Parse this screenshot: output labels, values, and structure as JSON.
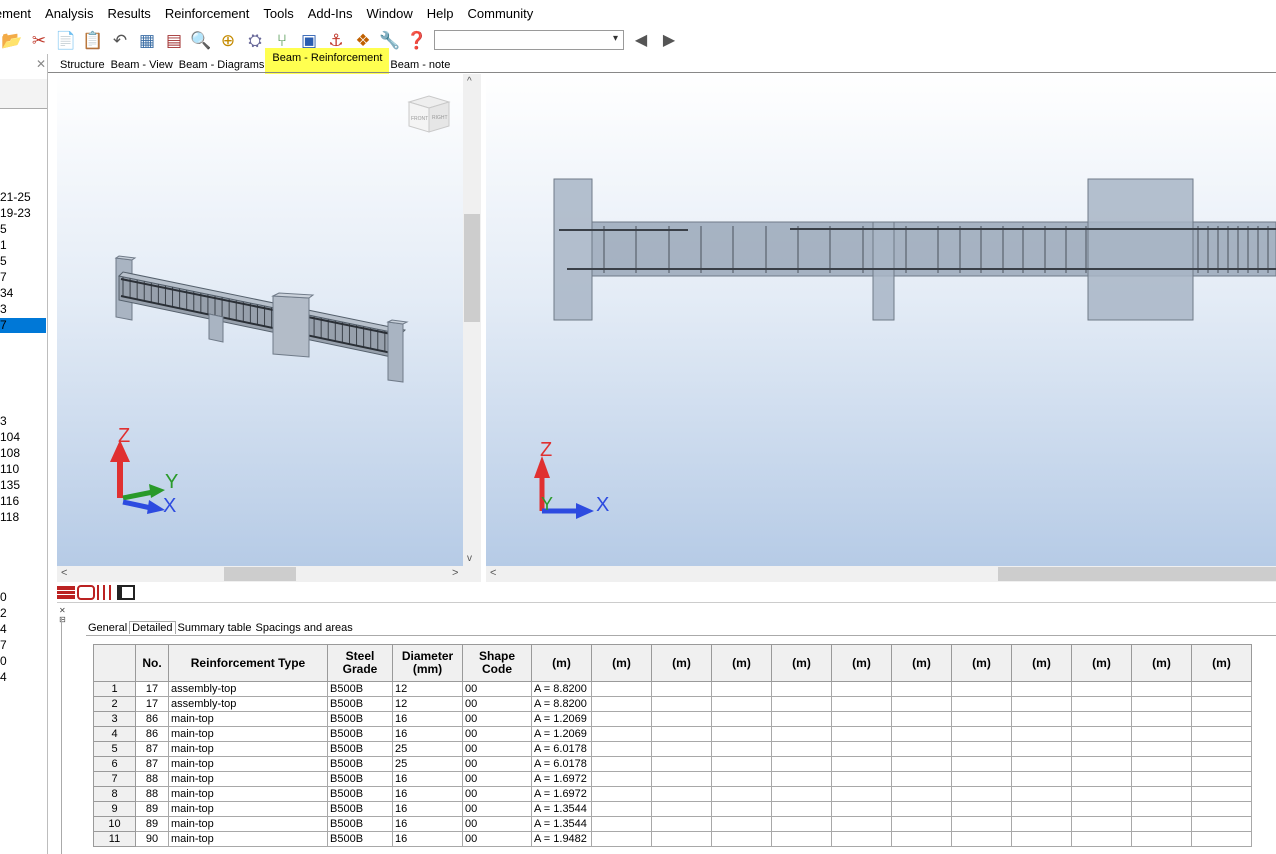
{
  "menu": [
    "lement",
    "Analysis",
    "Results",
    "Reinforcement",
    "Tools",
    "Add-Ins",
    "Window",
    "Help",
    "Community"
  ],
  "toolbar": {
    "icons": [
      "open-icon",
      "cut-icon",
      "copy-icon",
      "paste-icon",
      "undo-icon",
      "grid-icon",
      "calculator-icon",
      "zoom-icon",
      "zoom-window-icon",
      "model-icon",
      "branch-icon",
      "layout-icon",
      "rebar-icon",
      "structure-icon",
      "tools-icon",
      "help-icon"
    ],
    "combo_value": "",
    "nav_back": "◀",
    "nav_forward": "▶"
  },
  "left_panel": {
    "items": [
      {
        "text": "21-25",
        "selected": false
      },
      {
        "text": "19-23",
        "selected": false
      },
      {
        "text": "5",
        "selected": false
      },
      {
        "text": "1",
        "selected": false
      },
      {
        "text": "5",
        "selected": false
      },
      {
        "text": "7",
        "selected": false
      },
      {
        "text": "34",
        "selected": false
      },
      {
        "text": "3",
        "selected": false
      },
      {
        "text": "7",
        "selected": true
      },
      {
        "text": "3",
        "selected": false
      },
      {
        "text": "104",
        "selected": false
      },
      {
        "text": "108",
        "selected": false
      },
      {
        "text": "110",
        "selected": false
      },
      {
        "text": "135",
        "selected": false
      },
      {
        "text": "116",
        "selected": false
      },
      {
        "text": "118",
        "selected": false
      },
      {
        "text": "0",
        "selected": false
      },
      {
        "text": "2",
        "selected": false
      },
      {
        "text": "4",
        "selected": false
      },
      {
        "text": "7",
        "selected": false
      },
      {
        "text": "0",
        "selected": false
      },
      {
        "text": "4",
        "selected": false
      }
    ]
  },
  "doc_tabs": [
    {
      "label": "Structure",
      "active": false
    },
    {
      "label": "Beam - View",
      "active": false
    },
    {
      "label": "Beam - Diagrams",
      "active": false
    },
    {
      "label": "Beam - Reinforcement",
      "active": true
    },
    {
      "label": "Beam - note",
      "active": false
    }
  ],
  "left_view": {
    "cube_labels": [
      "FRONT",
      "RIGHT"
    ],
    "axes": {
      "z": "Z",
      "y": "Y",
      "x": "X"
    }
  },
  "right_view": {
    "axes": {
      "z": "Z",
      "y": "Y",
      "x": "X"
    }
  },
  "colors": {
    "highlight": "#ffff50",
    "selection": "#0078d7",
    "axis_z": "#e03030",
    "axis_y": "#2a9a2a",
    "axis_x": "#2d4be0"
  },
  "sub_tabs": [
    {
      "label": "General",
      "active": false
    },
    {
      "label": "Detailed",
      "active": true
    },
    {
      "label": "Summary table",
      "active": false
    },
    {
      "label": "Spacings and areas",
      "active": false
    }
  ],
  "table": {
    "headers": [
      "",
      "No.",
      "Reinforcement Type",
      "Steel Grade",
      "Diameter (mm)",
      "Shape Code",
      "(m)",
      "(m)",
      "(m)",
      "(m)",
      "(m)",
      "(m)",
      "(m)",
      "(m)",
      "(m)",
      "(m)",
      "(m)",
      "(m)"
    ],
    "rows": [
      [
        "1",
        "17",
        "assembly-top",
        "B500B",
        "12",
        "00",
        "A = 8.8200"
      ],
      [
        "2",
        "17",
        "assembly-top",
        "B500B",
        "12",
        "00",
        "A = 8.8200"
      ],
      [
        "3",
        "86",
        "main-top",
        "B500B",
        "16",
        "00",
        "A = 1.2069"
      ],
      [
        "4",
        "86",
        "main-top",
        "B500B",
        "16",
        "00",
        "A = 1.2069"
      ],
      [
        "5",
        "87",
        "main-top",
        "B500B",
        "25",
        "00",
        "A = 6.0178"
      ],
      [
        "6",
        "87",
        "main-top",
        "B500B",
        "25",
        "00",
        "A = 6.0178"
      ],
      [
        "7",
        "88",
        "main-top",
        "B500B",
        "16",
        "00",
        "A = 1.6972"
      ],
      [
        "8",
        "88",
        "main-top",
        "B500B",
        "16",
        "00",
        "A = 1.6972"
      ],
      [
        "9",
        "89",
        "main-top",
        "B500B",
        "16",
        "00",
        "A = 1.3544"
      ],
      [
        "10",
        "89",
        "main-top",
        "B500B",
        "16",
        "00",
        "A = 1.3544"
      ],
      [
        "11",
        "90",
        "main-top",
        "B500B",
        "16",
        "00",
        "A = 1.9482"
      ]
    ]
  }
}
